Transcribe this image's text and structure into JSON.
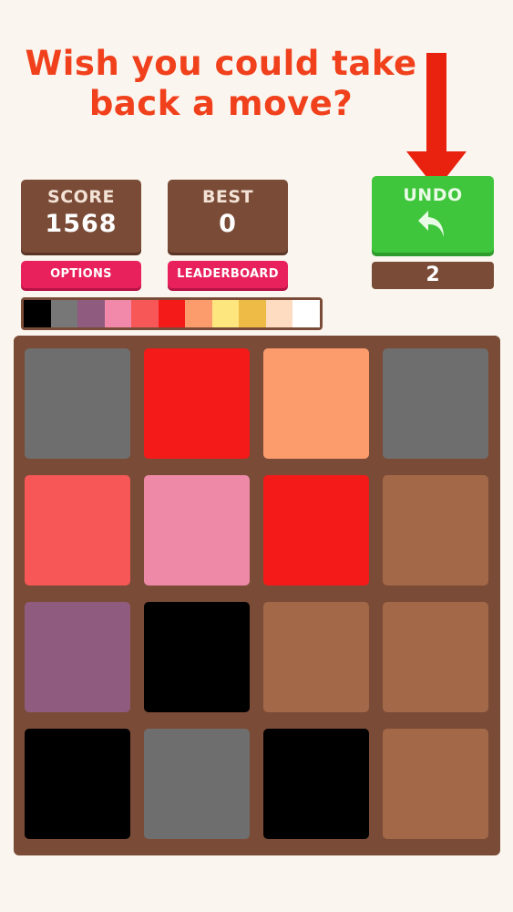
{
  "promo": {
    "line1": "Wish you could take",
    "line2": "back a move?"
  },
  "colors": {
    "headline": "#f0401c",
    "arrow": "#e8220f",
    "panel_brown": "#7a4b36",
    "undo_green": "#3fc63c",
    "pink_button": "#e8215d",
    "background": "#faf6ef"
  },
  "score": {
    "label": "SCORE",
    "value": "1568"
  },
  "best": {
    "label": "BEST",
    "value": "0"
  },
  "buttons": {
    "options": "OPTIONS",
    "leaderboard": "LEADERBOARD"
  },
  "undo": {
    "label": "UNDO",
    "icon": "undo-arrow-icon",
    "count": "2"
  },
  "palette": [
    "#000000",
    "#777777",
    "#8f5b7e",
    "#f289aa",
    "#f75757",
    "#f51a1a",
    "#fc9c6c",
    "#fde67e",
    "#efbb47",
    "#fddcc2",
    "#ffffff"
  ],
  "board": {
    "rows": [
      [
        "#6e6e6e",
        "#f51a1a",
        "#fc9c6c",
        "#6e6e6e"
      ],
      [
        "#f75757",
        "#ee8aa8",
        "#f51a1a",
        "#a36848"
      ],
      [
        "#8f5b7e",
        "#000000",
        "#a36848",
        "#a36848"
      ],
      [
        "#000000",
        "#6e6e6e",
        "#000000",
        "#a36848"
      ]
    ]
  }
}
